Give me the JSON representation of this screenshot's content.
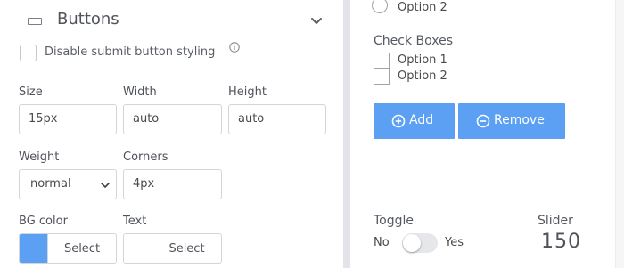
{
  "panel": {
    "section_icon": "rectangle-icon",
    "section_title": "Buttons",
    "collapse_icon": "chevron-down-icon",
    "disable_styling": {
      "label": "Disable submit button styling",
      "checked": false,
      "info_icon": "info-icon"
    },
    "size": {
      "label": "Size",
      "value": "15px"
    },
    "width": {
      "label": "Width",
      "value": "auto"
    },
    "height": {
      "label": "Height",
      "value": "auto"
    },
    "weight": {
      "label": "Weight",
      "value": "normal"
    },
    "corners": {
      "label": "Corners",
      "value": "4px"
    },
    "bg_color": {
      "label": "BG color",
      "button": "Select",
      "swatch": "#5ba0f2"
    },
    "text_color": {
      "label": "Text",
      "button": "Select",
      "swatch": "#ffffff"
    }
  },
  "preview": {
    "radio_option_2": "Option 2",
    "checkboxes": {
      "title": "Check Boxes",
      "options": [
        "Option 1",
        "Option 2"
      ]
    },
    "add_button": {
      "label": "Add",
      "icon": "plus-circle-icon"
    },
    "remove_button": {
      "label": "Remove",
      "icon": "minus-circle-icon"
    },
    "toggle": {
      "title": "Toggle",
      "off_label": "No",
      "on_label": "Yes",
      "on": false
    },
    "slider": {
      "title": "Slider",
      "value": "150"
    },
    "accent": "#5ba0f2"
  }
}
